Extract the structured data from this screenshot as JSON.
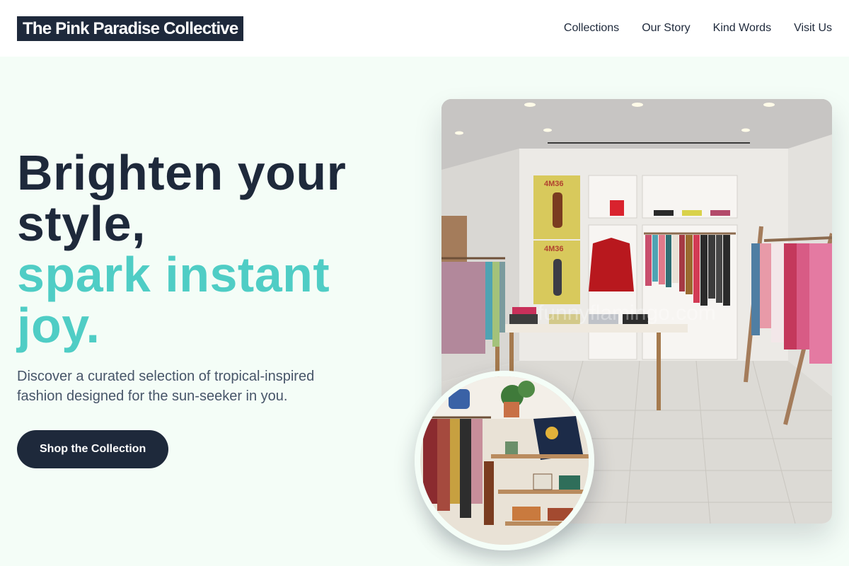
{
  "header": {
    "brand": "The Pink Paradise Collective",
    "nav": [
      "Collections",
      "Our Story",
      "Kind Words",
      "Visit Us"
    ]
  },
  "hero": {
    "headline_line1": "Brighten your",
    "headline_line2": "style,",
    "headline_line3": "spark instant",
    "headline_line4": "joy.",
    "subtitle": "Discover a curated selection of tropical-inspired fashion designed for the sun-seeker in you.",
    "cta_label": "Shop the Collection"
  },
  "images": {
    "store_photo": {
      "poster_text_1": "4M36",
      "poster_text_2": "4M36",
      "watermark": "funnyflamingo.com"
    },
    "boutique_photo": {}
  },
  "colors": {
    "dark": "#1e293b",
    "accent": "#4fcdc5",
    "background": "#f4fdf7"
  }
}
